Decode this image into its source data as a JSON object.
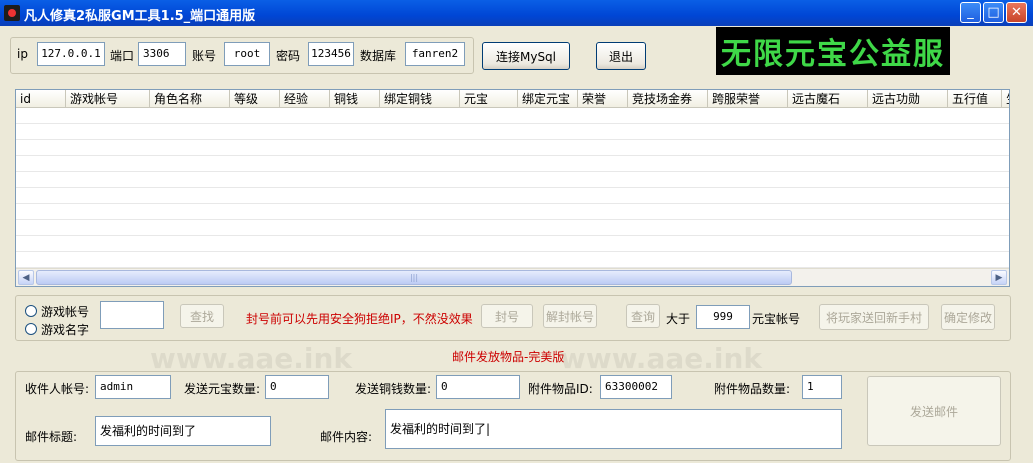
{
  "window": {
    "title": "凡人修真2私服GM工具1.5_端口通用版"
  },
  "connection": {
    "ip_label": "ip",
    "ip_value": "127.0.0.1",
    "port_label": "端口",
    "port_value": "3306",
    "account_label": "账号",
    "account_value": "root",
    "password_label": "密码",
    "password_value": "123456",
    "database_label": "数据库",
    "database_value": "fanren2",
    "connect_button": "连接MySql",
    "exit_button": "退出"
  },
  "banner": {
    "text": "无限元宝公益服"
  },
  "grid": {
    "columns": [
      "id",
      "游戏帐号",
      "角色名称",
      "等级",
      "经验",
      "铜钱",
      "绑定铜钱",
      "元宝",
      "绑定元宝",
      "荣誉",
      "竞技场金券",
      "跨服荣誉",
      "远古魔石",
      "远古功勋",
      "五行值",
      "生"
    ]
  },
  "search": {
    "radio_account": "游戏帐号",
    "radio_name": "游戏名字",
    "search_value": "",
    "search_button": "查找",
    "warning": "封号前可以先用安全狗拒绝IP，不然没效果",
    "ban_button": "封号",
    "unban_button": "解封帐号",
    "query_button": "查询",
    "greater_label": "大于",
    "greater_value": "999",
    "yuanbao_label": "元宝帐号",
    "send_novice_button": "将玩家送回新手村",
    "confirm_button": "确定修改"
  },
  "mail": {
    "section_title": "邮件发放物品-完美版",
    "recipient_label": "收件人帐号:",
    "recipient_value": "admin",
    "yuanbao_qty_label": "发送元宝数量:",
    "yuanbao_qty_value": "0",
    "copper_qty_label": "发送铜钱数量:",
    "copper_qty_value": "0",
    "item_id_label": "附件物品ID:",
    "item_id_value": "63300002",
    "item_qty_label": "附件物品数量:",
    "item_qty_value": "1",
    "subject_label": "邮件标题:",
    "subject_value": "发福利的时间到了",
    "content_label": "邮件内容:",
    "content_value": "发福利的时间到了|",
    "send_button": "发送邮件"
  },
  "watermark": {
    "text": "www.aae.ink"
  }
}
